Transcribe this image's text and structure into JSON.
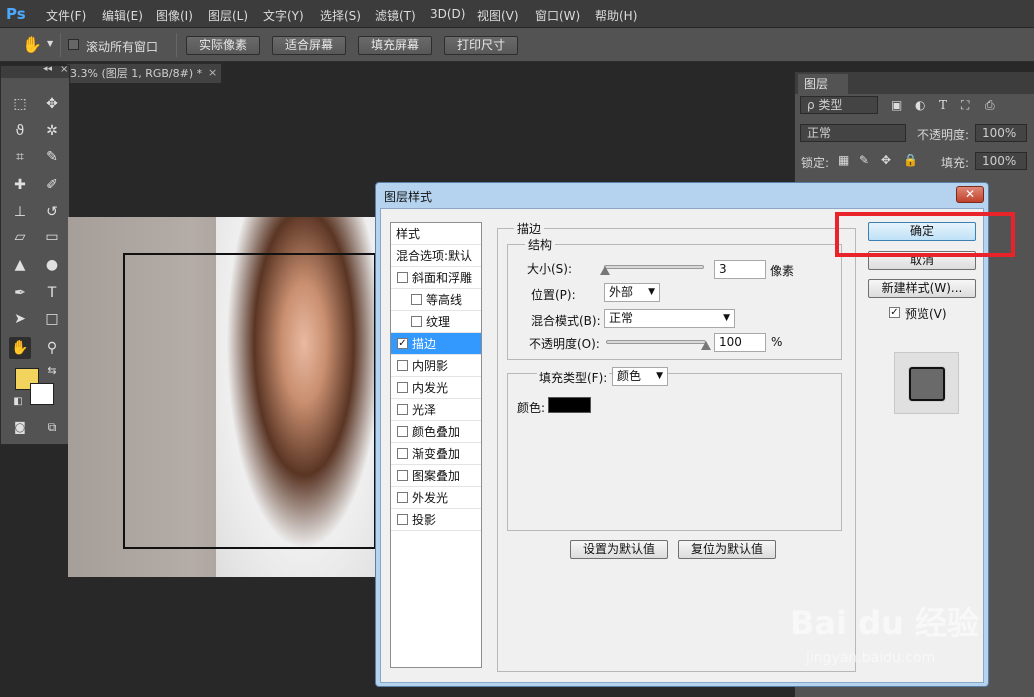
{
  "menubar": {
    "logo": "Ps",
    "items": [
      "文件(F)",
      "编辑(E)",
      "图像(I)",
      "图层(L)",
      "文字(Y)",
      "选择(S)",
      "滤镜(T)",
      "3D(D)",
      "视图(V)",
      "窗口(W)",
      "帮助(H)"
    ]
  },
  "options": {
    "scroll_all_label": "滚动所有窗口",
    "buttons": [
      "实际像素",
      "适合屏幕",
      "填充屏幕",
      "打印尺寸"
    ]
  },
  "document": {
    "tab_title": "3.3% (图层 1, RGB/8#) *",
    "close": "×"
  },
  "tools": {
    "collapse": "◂◂",
    "close": "×"
  },
  "layers_panel": {
    "tab": "图层",
    "filter_label": "ρ 类型",
    "blend_mode": "正常",
    "opacity_label": "不透明度:",
    "opacity_value": "100%",
    "lock_label": "锁定:",
    "fill_label": "填充:",
    "fill_value": "100%"
  },
  "dialog": {
    "title": "图层样式",
    "close": "✕",
    "style_list": {
      "header": "样式",
      "blend_options": "混合选项:默认",
      "items": [
        {
          "label": "斜面和浮雕",
          "checked": false
        },
        {
          "label": "等高线",
          "checked": false
        },
        {
          "label": "纹理",
          "checked": false
        },
        {
          "label": "描边",
          "checked": true
        },
        {
          "label": "内阴影",
          "checked": false
        },
        {
          "label": "内发光",
          "checked": false
        },
        {
          "label": "光泽",
          "checked": false
        },
        {
          "label": "颜色叠加",
          "checked": false
        },
        {
          "label": "渐变叠加",
          "checked": false
        },
        {
          "label": "图案叠加",
          "checked": false
        },
        {
          "label": "外发光",
          "checked": false
        },
        {
          "label": "投影",
          "checked": false
        }
      ]
    },
    "stroke": {
      "section_title": "描边",
      "structure_title": "结构",
      "size_label": "大小(S):",
      "size_value": "3",
      "size_unit": "像素",
      "position_label": "位置(P):",
      "position_value": "外部",
      "blend_label": "混合模式(B):",
      "blend_value": "正常",
      "opacity_label": "不透明度(O):",
      "opacity_value": "100",
      "opacity_unit": "%",
      "fill_type_label": "填充类型(F):",
      "fill_type_value": "颜色",
      "color_label": "颜色:",
      "color_value": "#000000",
      "size_fraction": 0.01,
      "opacity_fraction": 1.0,
      "set_default": "设置为默认值",
      "reset_default": "复位为默认值"
    },
    "buttons": {
      "ok": "确定",
      "cancel": "取消",
      "new_style": "新建样式(W)...",
      "preview": "预览(V)",
      "preview_checked": true
    }
  },
  "watermark": {
    "text": "Bai du 经验",
    "url": "jingyan.baidu.com"
  },
  "colors": {
    "foreground": "#f2d35e",
    "background": "#ffffff",
    "highlight": "#e8242a"
  }
}
